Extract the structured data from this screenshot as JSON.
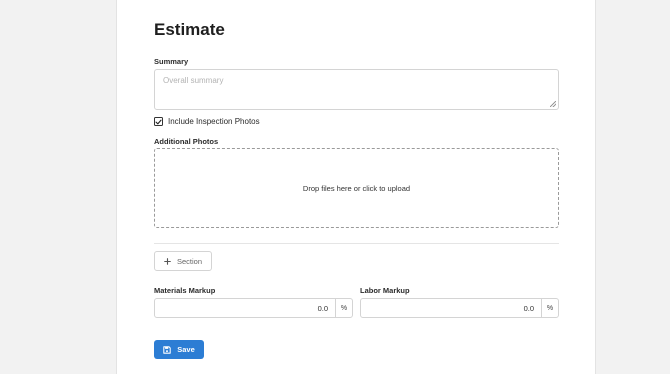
{
  "page": {
    "title": "Estimate"
  },
  "summary": {
    "label": "Summary",
    "placeholder": "Overall summary",
    "value": ""
  },
  "include_photos": {
    "label": "Include Inspection Photos",
    "checked": true
  },
  "additional_photos": {
    "label": "Additional Photos",
    "dropzone_text": "Drop files here or click to upload"
  },
  "section_button": {
    "label": "Section",
    "icon": "plus-icon"
  },
  "materials_markup": {
    "label": "Materials Markup",
    "value": "0.0",
    "unit": "%"
  },
  "labor_markup": {
    "label": "Labor Markup",
    "value": "0.0",
    "unit": "%"
  },
  "save_button": {
    "label": "Save",
    "icon": "floppy-disk-icon"
  },
  "colors": {
    "primary": "#2c7dd4",
    "background": "#f2f2f2",
    "card": "#ffffff"
  }
}
